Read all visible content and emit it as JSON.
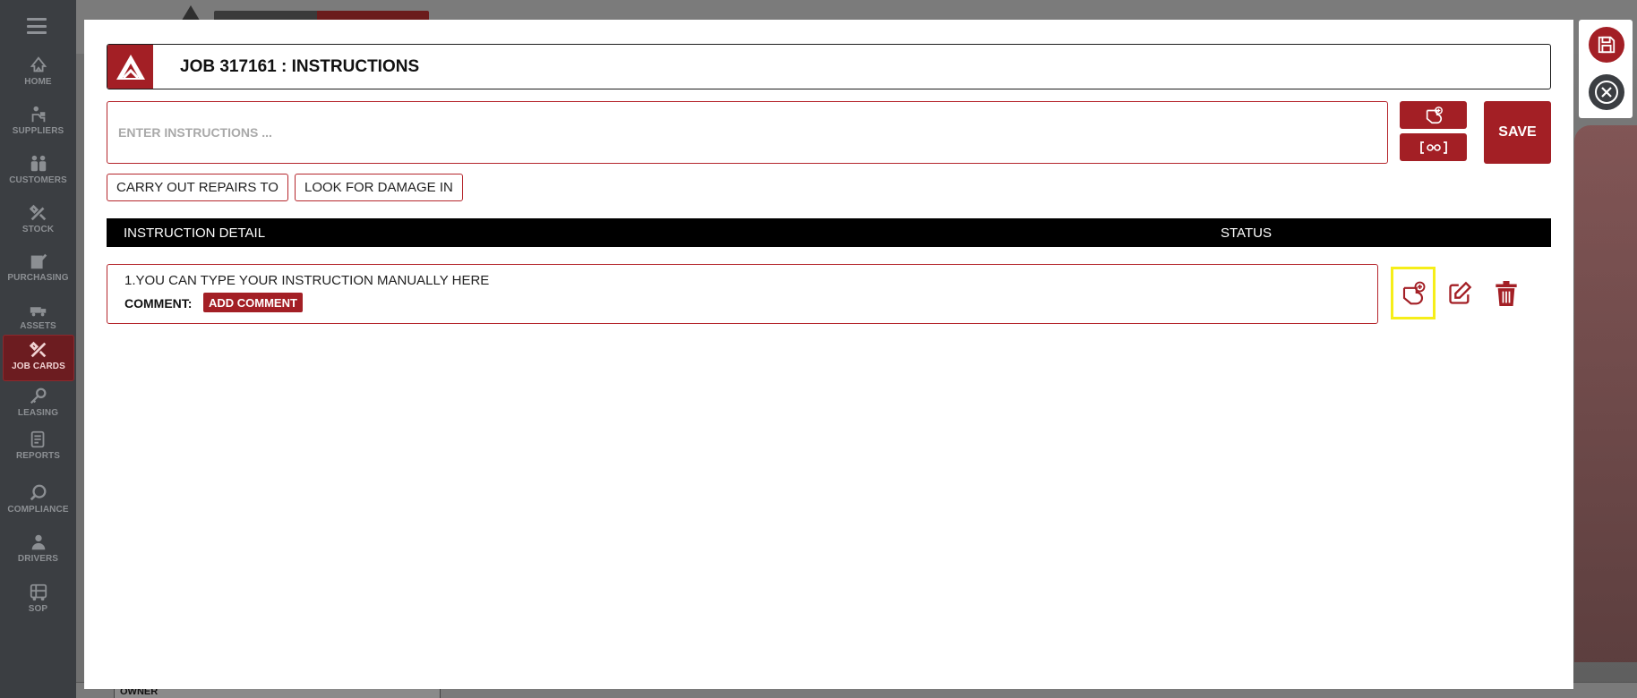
{
  "sidebar": {
    "items": [
      {
        "label": "HOME",
        "icon": "home-icon"
      },
      {
        "label": "SUPPLIERS",
        "icon": "suppliers-icon"
      },
      {
        "label": "CUSTOMERS",
        "icon": "customers-icon"
      },
      {
        "label": "STOCK",
        "icon": "stock-icon"
      },
      {
        "label": "PURCHASING",
        "icon": "purchasing-icon"
      },
      {
        "label": "ASSETS",
        "icon": "assets-icon"
      },
      {
        "label": "JOB CARDS",
        "icon": "job-cards-icon",
        "active": true
      },
      {
        "label": "LEASING",
        "icon": "leasing-icon"
      },
      {
        "label": "REPORTS",
        "icon": "reports-icon"
      },
      {
        "label": "COMPLIANCE",
        "icon": "compliance-icon"
      },
      {
        "label": "DRIVERS",
        "icon": "drivers-icon"
      },
      {
        "label": "SOP",
        "icon": "sop-icon"
      }
    ]
  },
  "modal": {
    "title": "JOB 317161 : INSTRUCTIONS",
    "input_placeholder": "ENTER INSTRUCTIONS ...",
    "save_label": "SAVE",
    "quick_chips": [
      "CARRY OUT REPAIRS TO",
      "LOOK FOR DAMAGE IN"
    ],
    "table": {
      "headers": {
        "detail": "INSTRUCTION DETAIL",
        "status": "STATUS"
      },
      "rows": [
        {
          "text": "1.YOU CAN TYPE YOUR INSTRUCTION MANUALLY HERE",
          "comment_label": "COMMENT:",
          "comment_button": "ADD COMMENT"
        }
      ]
    }
  },
  "background": {
    "owner_label": "OWNER"
  },
  "colors": {
    "accent": "#a31f25",
    "highlight": "#f6ee19",
    "sidebar": "#3b3e42"
  }
}
